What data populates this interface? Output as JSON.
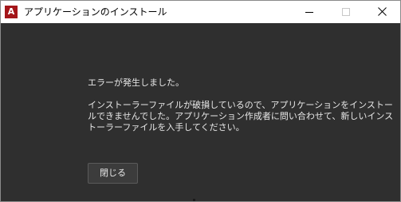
{
  "window": {
    "title": "アプリケーションのインストール",
    "app_icon_letter": "A",
    "app_icon_color": "#a4161a",
    "background_color": "#2f2f2f"
  },
  "dialog": {
    "headline": "エラーが発生しました。",
    "message": "インストーラーファイルが破損しているので、アプリケーションをインストールできませんでした。アプリケーション作成者に問い合わせて、新しいインストーラーファイルを入手してください。",
    "close_button_label": "閉じる"
  }
}
